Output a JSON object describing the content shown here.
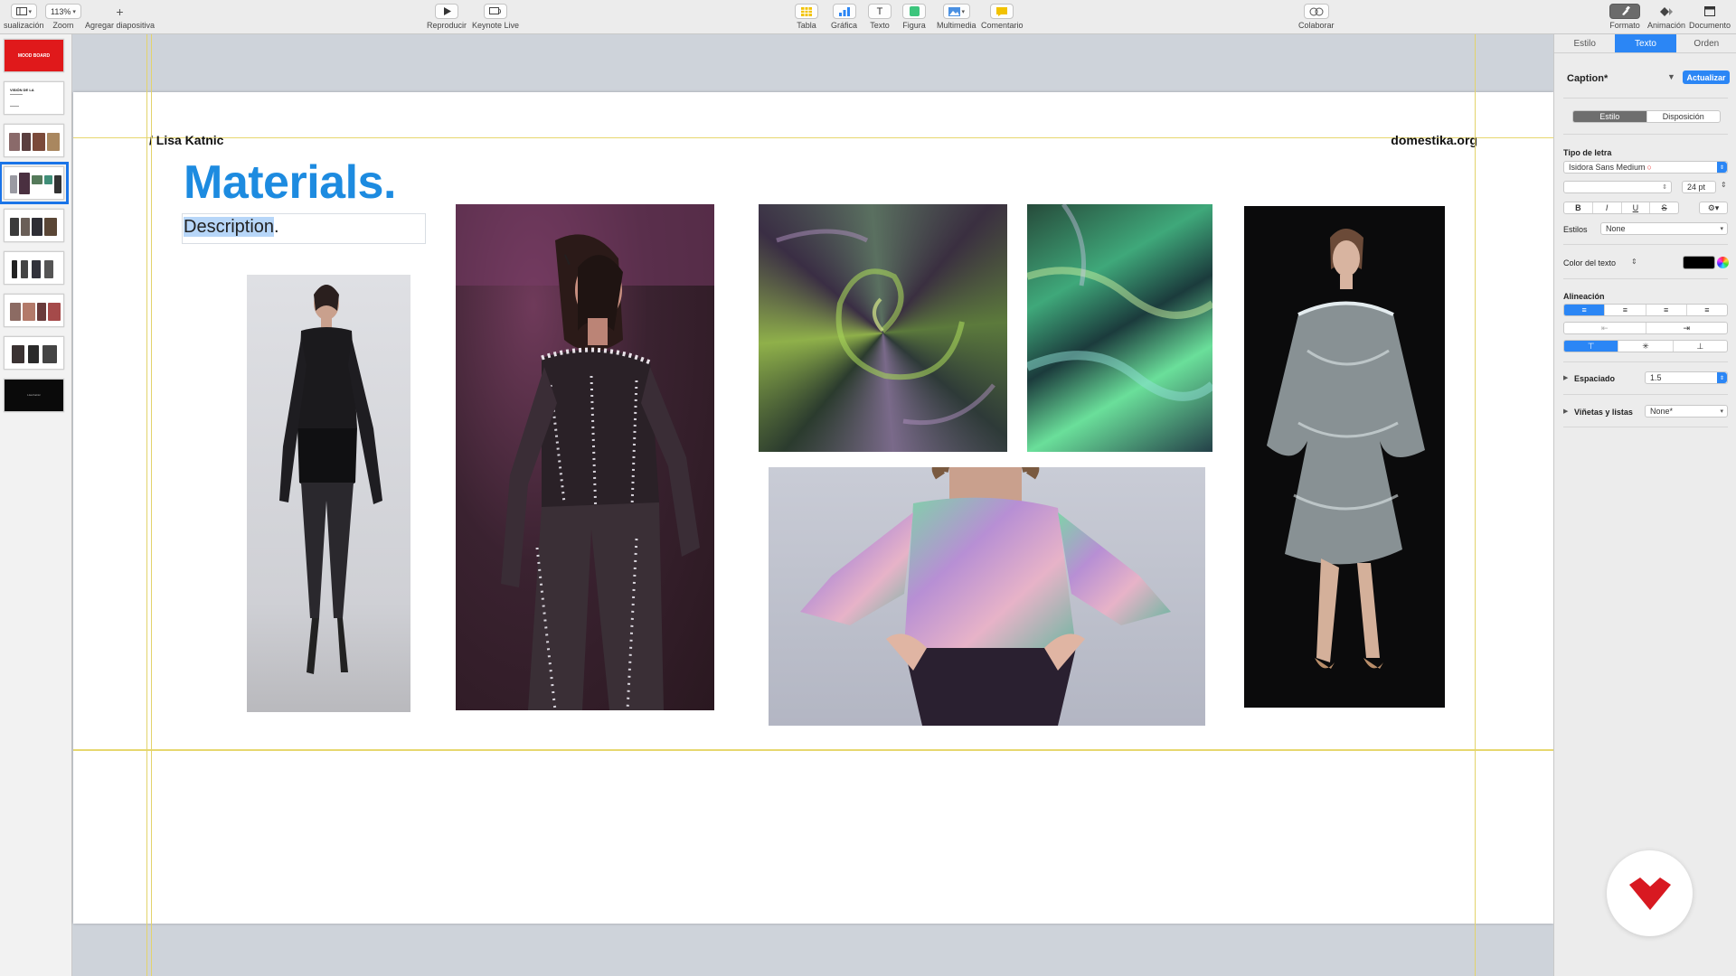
{
  "toolbar": {
    "view_label": "sualización",
    "zoom_value": "113%",
    "zoom_label": "Zoom",
    "add_slide_label": "Agregar diapositiva",
    "play_label": "Reproducir",
    "keynote_live_label": "Keynote Live",
    "table_label": "Tabla",
    "chart_label": "Gráfica",
    "text_label": "Texto",
    "shape_label": "Figura",
    "media_label": "Multimedia",
    "comment_label": "Comentario",
    "collaborate_label": "Colaborar",
    "format_label": "Formato",
    "animate_label": "Animación",
    "document_label": "Documento"
  },
  "navigator": {
    "thumbnails": [
      {
        "text": "MOOD BOARD",
        "kind": "red"
      },
      {
        "text": "VISIÓN DE LA",
        "kind": "text"
      },
      {
        "text": "",
        "kind": "images"
      },
      {
        "text": "",
        "kind": "images",
        "selected": true
      },
      {
        "text": "",
        "kind": "images"
      },
      {
        "text": "",
        "kind": "images"
      },
      {
        "text": "",
        "kind": "images"
      },
      {
        "text": "",
        "kind": "images"
      },
      {
        "text": "Lisa Katnic",
        "kind": "black"
      }
    ]
  },
  "slide": {
    "author": "/ Lisa Katnic",
    "site": "domestika.org",
    "title": "Materials.",
    "description_selected": "Description",
    "description_rest": "."
  },
  "inspector": {
    "tabs": [
      "Estilo",
      "Texto",
      "Orden"
    ],
    "active_tab": "Texto",
    "paragraph_style": "Caption*",
    "update_button": "Actualizar",
    "subtabs": [
      "Estilo",
      "Disposición"
    ],
    "font_section": "Tipo de letra",
    "font_name": "Isidora Sans Medium",
    "font_size": "24 pt",
    "bold": "B",
    "italic": "I",
    "underline": "U",
    "strike": "S",
    "styles_label": "Estilos",
    "styles_value": "None",
    "text_color_label": "Color del texto",
    "alignment_label": "Alineación",
    "spacing_label": "Espaciado",
    "spacing_value": "1.5",
    "bullets_label": "Viñetas y listas",
    "bullets_value": "None*"
  },
  "colors": {
    "accent": "#2b86f5",
    "title_blue": "#1d8be0",
    "guide_yellow": "#e7d76f",
    "domestika_red": "#d81921"
  }
}
